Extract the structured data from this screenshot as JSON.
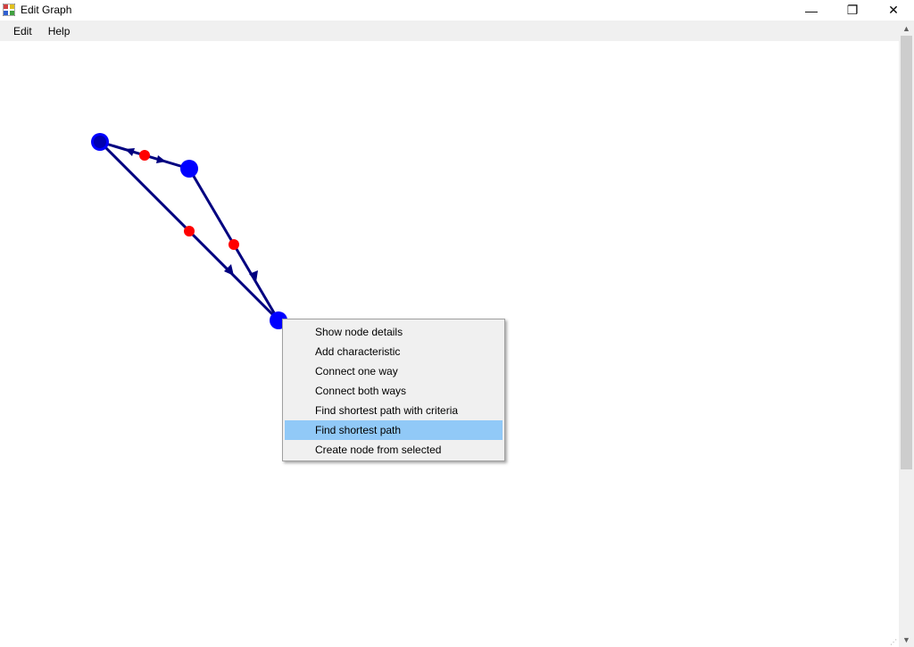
{
  "window": {
    "title": "Edit Graph",
    "controls": {
      "minimize": "—",
      "maximize": "❐",
      "close": "✕"
    }
  },
  "menubar": {
    "items": [
      {
        "label": "Edit"
      },
      {
        "label": "Help"
      }
    ]
  },
  "graph": {
    "node_color": "#0000ff",
    "selected_node_color": "#0000c0",
    "edge_color": "#000080",
    "edge_midpoint_color": "#ff0000"
  },
  "context_menu": {
    "items": [
      {
        "label": "Show node details",
        "highlighted": false
      },
      {
        "label": "Add characteristic",
        "highlighted": false
      },
      {
        "label": "Connect one way",
        "highlighted": false
      },
      {
        "label": "Connect both ways",
        "highlighted": false
      },
      {
        "label": "Find shortest path with criteria",
        "highlighted": false
      },
      {
        "label": "Find shortest path",
        "highlighted": true
      },
      {
        "label": "Create node from selected",
        "highlighted": false
      }
    ]
  }
}
